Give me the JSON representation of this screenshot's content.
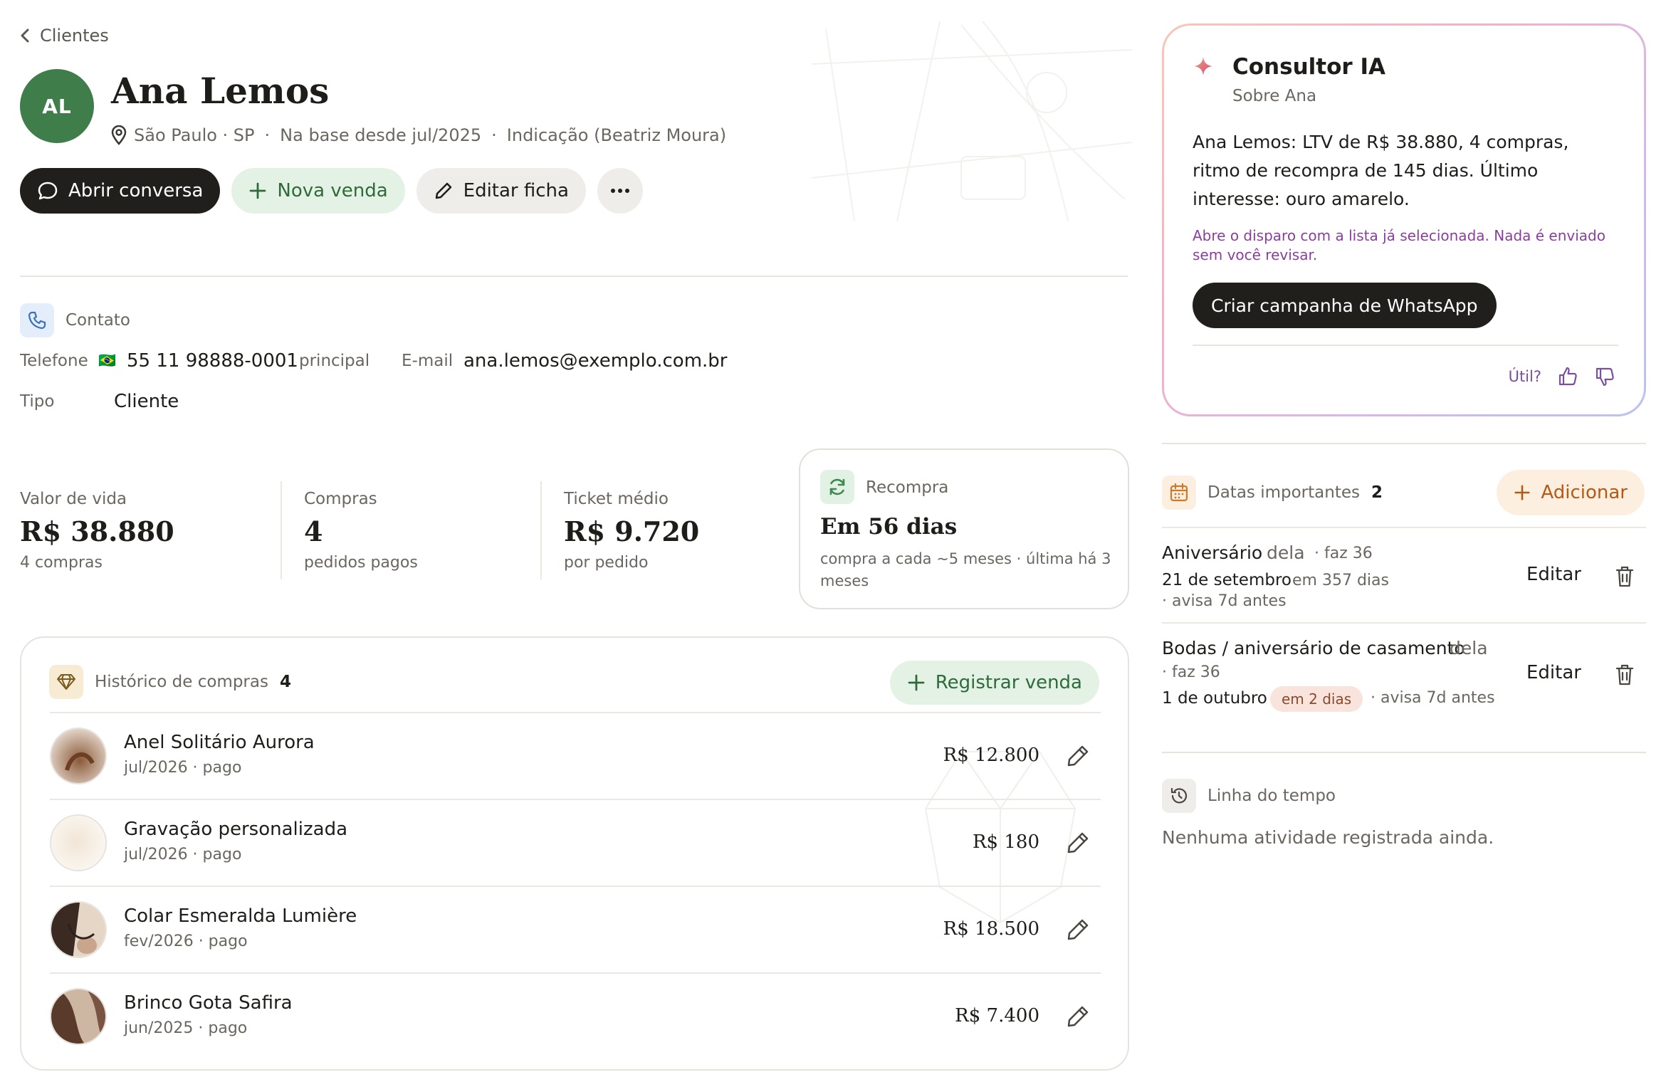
{
  "colors": {
    "primary_dark": "#211f1c",
    "avatar_green": "#3f7d4a",
    "green_soft": "#e4f2e6",
    "green_text": "#2f6b3a",
    "muted_text": "#6b6660",
    "ai_purple": "#8a3f9c",
    "peach": "#fcefdf",
    "alert_pill": "#f8e4dc"
  },
  "breadcrumb": {
    "back_label": "Clientes"
  },
  "customer": {
    "initials": "AL",
    "name": "Ana Lemos",
    "location": "São Paulo · SP",
    "since": "Na base desde jul/2025",
    "referral": "Indicação (Beatriz Moura)"
  },
  "actions": {
    "open_chat": "Abrir conversa",
    "new_sale": "Nova venda",
    "edit_record": "Editar ficha"
  },
  "contact": {
    "heading": "Contato",
    "phone_label": "Telefone",
    "phone_flag": "🇧🇷",
    "phone_value": "55 11 98888-0001",
    "phone_tag": "principal",
    "email_label": "E-mail",
    "email_value": "ana.lemos@exemplo.com.br",
    "type_label": "Tipo",
    "type_value": "Cliente"
  },
  "stats": {
    "ltv": {
      "label": "Valor de vida",
      "value": "R$ 38.880",
      "sub": "4 compras"
    },
    "purchases": {
      "label": "Compras",
      "value": "4",
      "sub": "pedidos pagos"
    },
    "ticket": {
      "label": "Ticket médio",
      "value": "R$ 9.720",
      "sub": "por pedido"
    },
    "repurchase": {
      "label": "Recompra",
      "value": "Em 56 dias",
      "sub_line1": "compra a cada ~5 meses · última há 3",
      "sub_line2": "meses"
    }
  },
  "history": {
    "title": "Histórico de compras",
    "count": "4",
    "register_button": "Registrar venda",
    "items": [
      {
        "name": "Anel Solitário Aurora",
        "sub": "jul/2026 · pago",
        "price": "R$ 12.800"
      },
      {
        "name": "Gravação personalizada",
        "sub": "jul/2026 · pago",
        "price": "R$ 180"
      },
      {
        "name": "Colar Esmeralda Lumière",
        "sub": "fev/2026 · pago",
        "price": "R$ 18.500"
      },
      {
        "name": "Brinco Gota Safira",
        "sub": "jun/2025 · pago",
        "price": "R$ 7.400"
      }
    ]
  },
  "ai": {
    "title": "Consultor IA",
    "subtitle": "Sobre Ana",
    "summary": "Ana Lemos: LTV de R$ 38.880, 4 compras, ritmo de recompra de 145 dias. Último interesse: ouro amarelo.",
    "note": "Abre o disparo com a lista já selecionada. Nada é enviado sem você revisar.",
    "cta": "Criar campanha de WhatsApp",
    "feedback_label": "Útil?"
  },
  "dates": {
    "title": "Datas importantes",
    "count": "2",
    "add_button": "Adicionar",
    "edit_label": "Editar",
    "items": [
      {
        "name": "Aniversário",
        "who": "dela",
        "age": "· faz 36",
        "date": "21 de setembro",
        "in": "em 357 dias",
        "notice": "· avisa 7d antes"
      },
      {
        "name": "Bodas / aniversário de casamento",
        "who": "dela",
        "age": "· faz 36",
        "date": "1 de outubro",
        "in": "em 2 dias",
        "notice": "· avisa 7d antes"
      }
    ]
  },
  "timeline": {
    "title": "Linha do tempo",
    "empty": "Nenhuma atividade registrada ainda."
  }
}
